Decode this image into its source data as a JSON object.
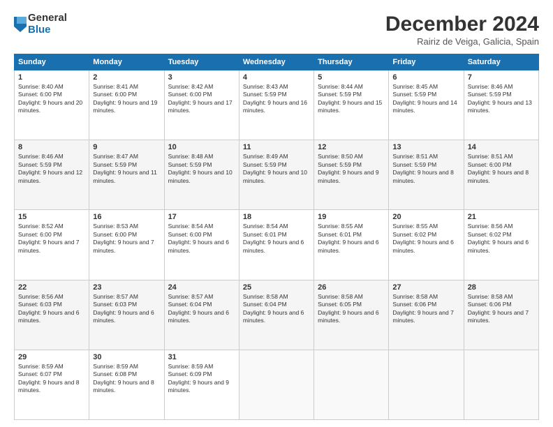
{
  "logo": {
    "general": "General",
    "blue": "Blue"
  },
  "title": "December 2024",
  "location": "Rairiz de Veiga, Galicia, Spain",
  "headers": [
    "Sunday",
    "Monday",
    "Tuesday",
    "Wednesday",
    "Thursday",
    "Friday",
    "Saturday"
  ],
  "weeks": [
    [
      {
        "day": "1",
        "info": "Sunrise: 8:40 AM\nSunset: 6:00 PM\nDaylight: 9 hours and 20 minutes."
      },
      {
        "day": "2",
        "info": "Sunrise: 8:41 AM\nSunset: 6:00 PM\nDaylight: 9 hours and 19 minutes."
      },
      {
        "day": "3",
        "info": "Sunrise: 8:42 AM\nSunset: 6:00 PM\nDaylight: 9 hours and 17 minutes."
      },
      {
        "day": "4",
        "info": "Sunrise: 8:43 AM\nSunset: 5:59 PM\nDaylight: 9 hours and 16 minutes."
      },
      {
        "day": "5",
        "info": "Sunrise: 8:44 AM\nSunset: 5:59 PM\nDaylight: 9 hours and 15 minutes."
      },
      {
        "day": "6",
        "info": "Sunrise: 8:45 AM\nSunset: 5:59 PM\nDaylight: 9 hours and 14 minutes."
      },
      {
        "day": "7",
        "info": "Sunrise: 8:46 AM\nSunset: 5:59 PM\nDaylight: 9 hours and 13 minutes."
      }
    ],
    [
      {
        "day": "8",
        "info": "Sunrise: 8:46 AM\nSunset: 5:59 PM\nDaylight: 9 hours and 12 minutes."
      },
      {
        "day": "9",
        "info": "Sunrise: 8:47 AM\nSunset: 5:59 PM\nDaylight: 9 hours and 11 minutes."
      },
      {
        "day": "10",
        "info": "Sunrise: 8:48 AM\nSunset: 5:59 PM\nDaylight: 9 hours and 10 minutes."
      },
      {
        "day": "11",
        "info": "Sunrise: 8:49 AM\nSunset: 5:59 PM\nDaylight: 9 hours and 10 minutes."
      },
      {
        "day": "12",
        "info": "Sunrise: 8:50 AM\nSunset: 5:59 PM\nDaylight: 9 hours and 9 minutes."
      },
      {
        "day": "13",
        "info": "Sunrise: 8:51 AM\nSunset: 5:59 PM\nDaylight: 9 hours and 8 minutes."
      },
      {
        "day": "14",
        "info": "Sunrise: 8:51 AM\nSunset: 6:00 PM\nDaylight: 9 hours and 8 minutes."
      }
    ],
    [
      {
        "day": "15",
        "info": "Sunrise: 8:52 AM\nSunset: 6:00 PM\nDaylight: 9 hours and 7 minutes."
      },
      {
        "day": "16",
        "info": "Sunrise: 8:53 AM\nSunset: 6:00 PM\nDaylight: 9 hours and 7 minutes."
      },
      {
        "day": "17",
        "info": "Sunrise: 8:54 AM\nSunset: 6:00 PM\nDaylight: 9 hours and 6 minutes."
      },
      {
        "day": "18",
        "info": "Sunrise: 8:54 AM\nSunset: 6:01 PM\nDaylight: 9 hours and 6 minutes."
      },
      {
        "day": "19",
        "info": "Sunrise: 8:55 AM\nSunset: 6:01 PM\nDaylight: 9 hours and 6 minutes."
      },
      {
        "day": "20",
        "info": "Sunrise: 8:55 AM\nSunset: 6:02 PM\nDaylight: 9 hours and 6 minutes."
      },
      {
        "day": "21",
        "info": "Sunrise: 8:56 AM\nSunset: 6:02 PM\nDaylight: 9 hours and 6 minutes."
      }
    ],
    [
      {
        "day": "22",
        "info": "Sunrise: 8:56 AM\nSunset: 6:03 PM\nDaylight: 9 hours and 6 minutes."
      },
      {
        "day": "23",
        "info": "Sunrise: 8:57 AM\nSunset: 6:03 PM\nDaylight: 9 hours and 6 minutes."
      },
      {
        "day": "24",
        "info": "Sunrise: 8:57 AM\nSunset: 6:04 PM\nDaylight: 9 hours and 6 minutes."
      },
      {
        "day": "25",
        "info": "Sunrise: 8:58 AM\nSunset: 6:04 PM\nDaylight: 9 hours and 6 minutes."
      },
      {
        "day": "26",
        "info": "Sunrise: 8:58 AM\nSunset: 6:05 PM\nDaylight: 9 hours and 6 minutes."
      },
      {
        "day": "27",
        "info": "Sunrise: 8:58 AM\nSunset: 6:06 PM\nDaylight: 9 hours and 7 minutes."
      },
      {
        "day": "28",
        "info": "Sunrise: 8:58 AM\nSunset: 6:06 PM\nDaylight: 9 hours and 7 minutes."
      }
    ],
    [
      {
        "day": "29",
        "info": "Sunrise: 8:59 AM\nSunset: 6:07 PM\nDaylight: 9 hours and 8 minutes."
      },
      {
        "day": "30",
        "info": "Sunrise: 8:59 AM\nSunset: 6:08 PM\nDaylight: 9 hours and 8 minutes."
      },
      {
        "day": "31",
        "info": "Sunrise: 8:59 AM\nSunset: 6:09 PM\nDaylight: 9 hours and 9 minutes."
      },
      {
        "day": "",
        "info": ""
      },
      {
        "day": "",
        "info": ""
      },
      {
        "day": "",
        "info": ""
      },
      {
        "day": "",
        "info": ""
      }
    ]
  ]
}
